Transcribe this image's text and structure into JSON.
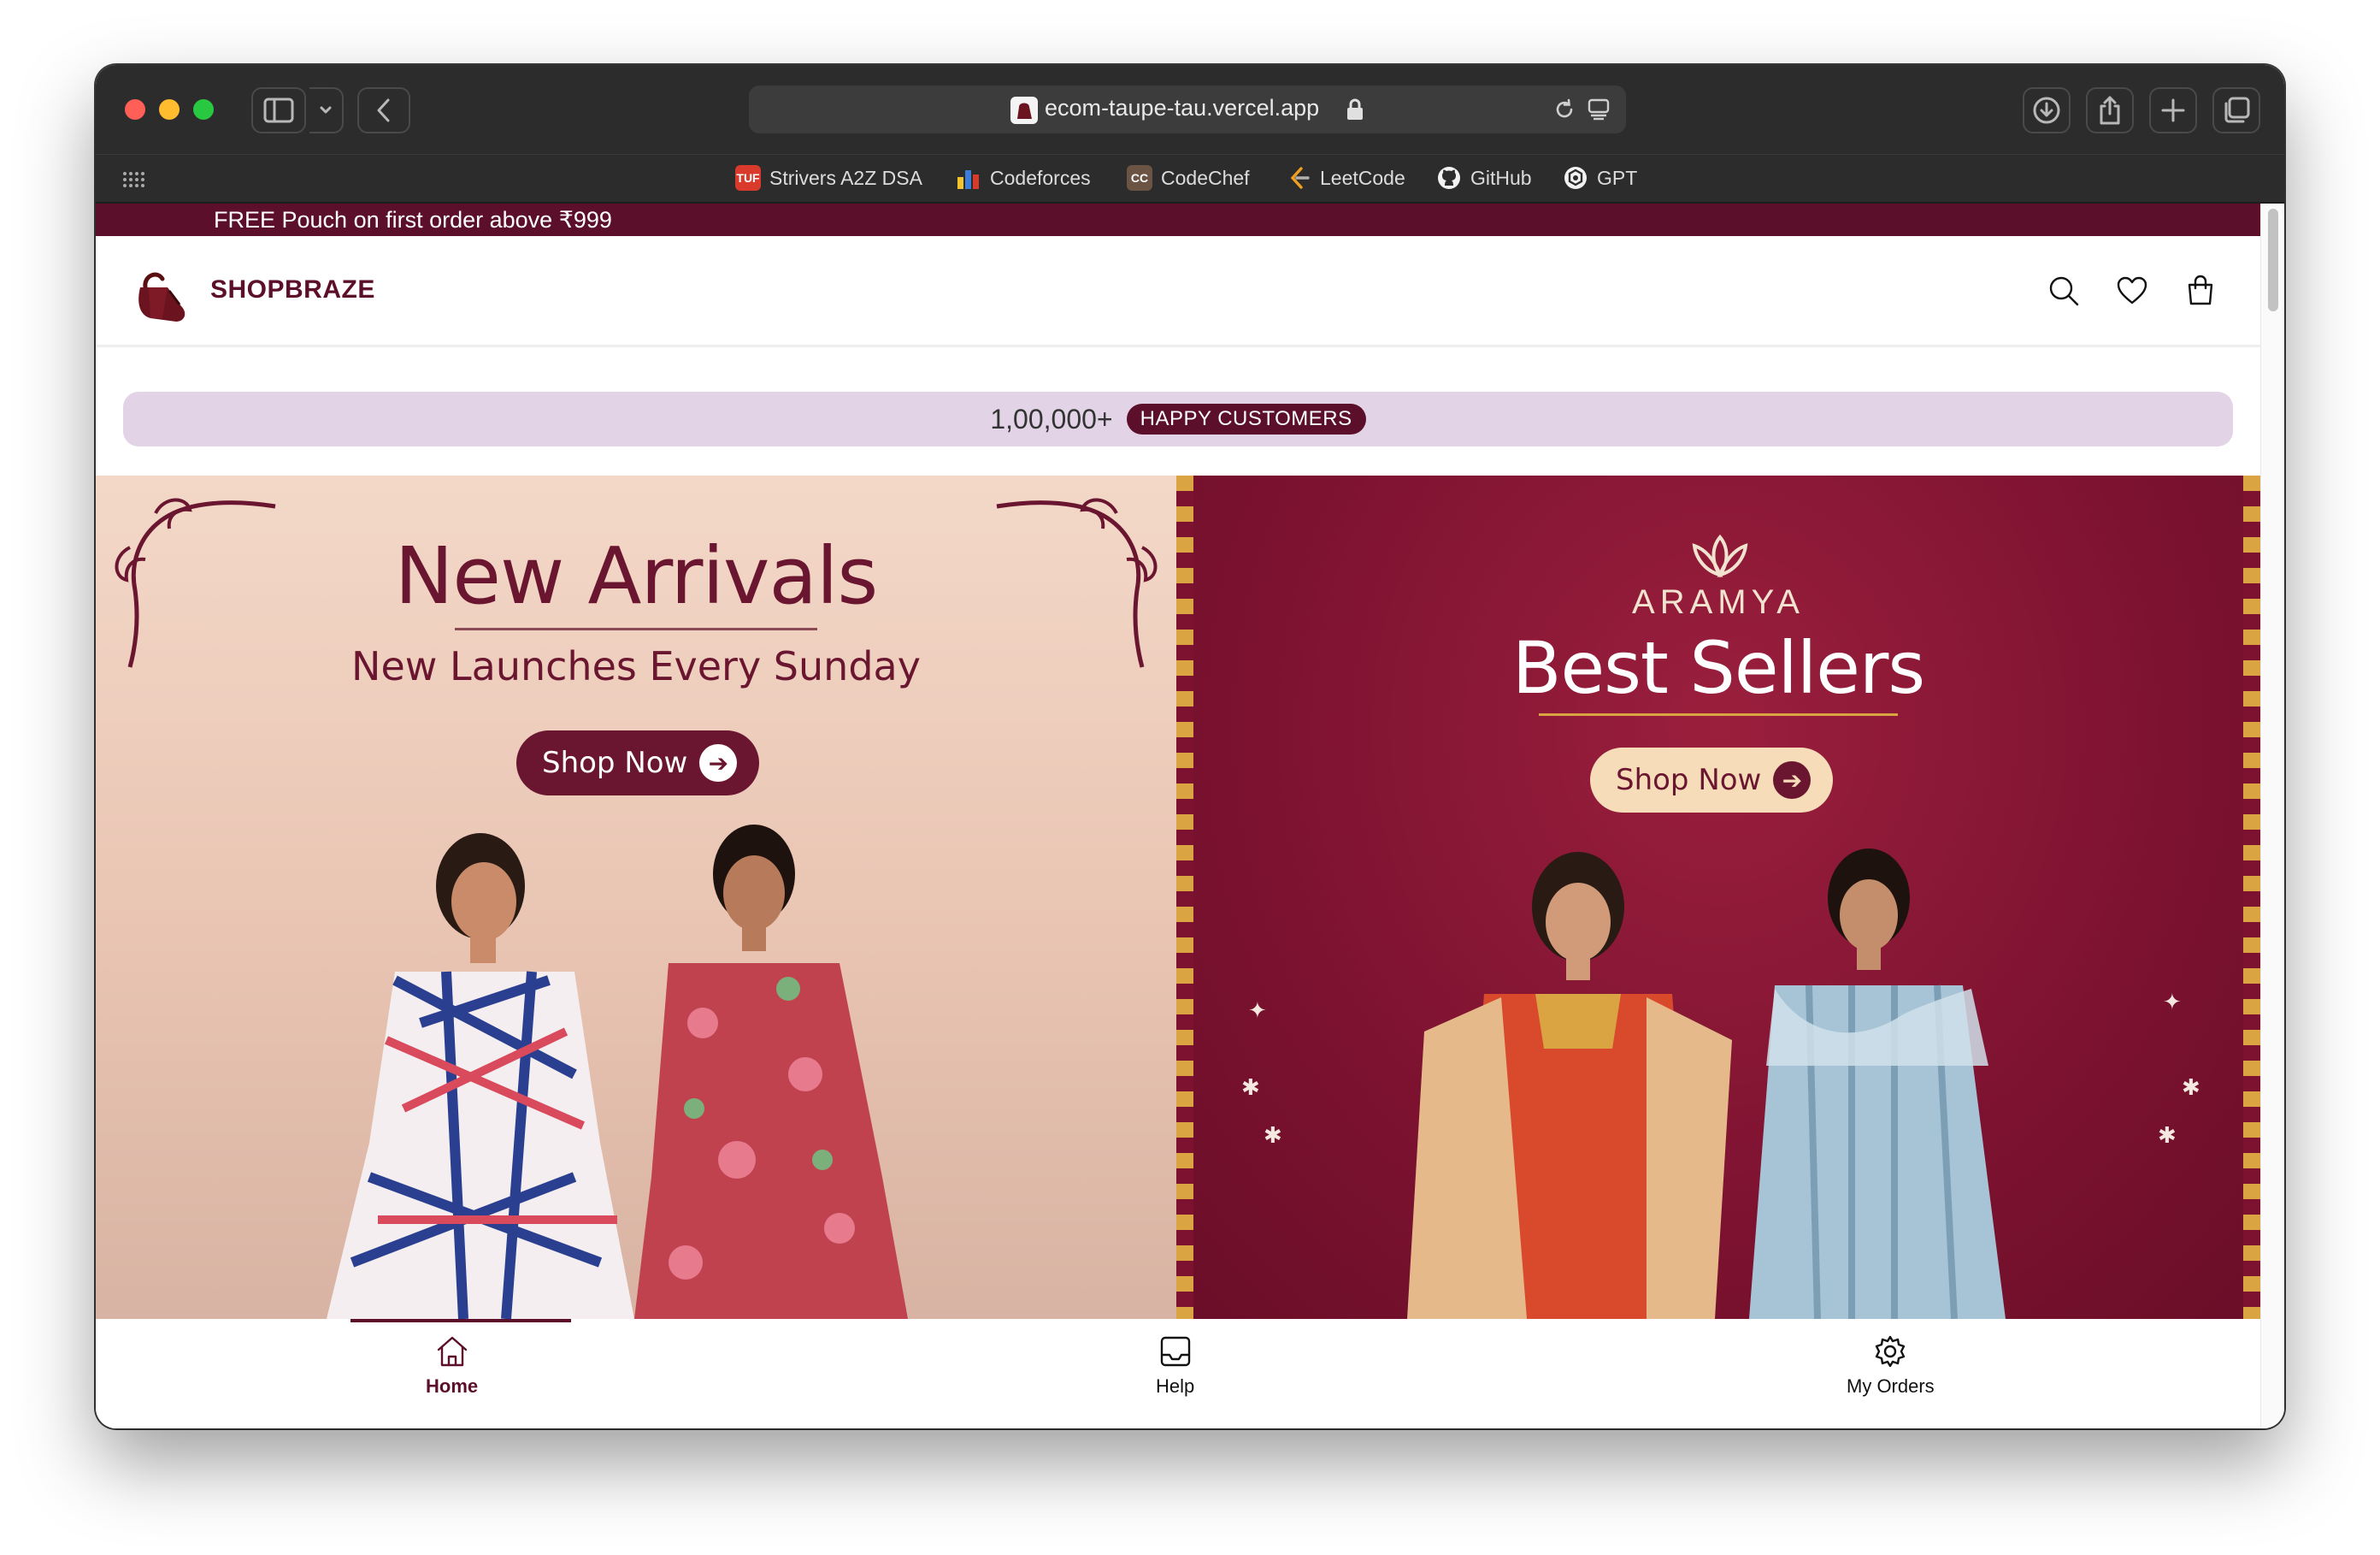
{
  "browser": {
    "url": "ecom-taupe-tau.vercel.app",
    "favorites": [
      {
        "label": "Strivers A2Z DSA",
        "icon": "tuf-icon",
        "color": "#d93a2b"
      },
      {
        "label": "Codeforces",
        "icon": "codeforces-icon",
        "color": "#3b7dd8"
      },
      {
        "label": "CodeChef",
        "icon": "codechef-icon",
        "color": "#6b5444"
      },
      {
        "label": "LeetCode",
        "icon": "leetcode-icon",
        "color": "#f0a020"
      },
      {
        "label": "GitHub",
        "icon": "github-icon",
        "color": "#ffffff"
      },
      {
        "label": "GPT",
        "icon": "openai-icon",
        "color": "#ffffff"
      }
    ]
  },
  "promo": {
    "text": "FREE Pouch on first order above ₹999"
  },
  "header": {
    "brand": "SHOPBRAZE"
  },
  "stats": {
    "count": "1,00,000+",
    "badge": "HAPPY CUSTOMERS"
  },
  "banners": {
    "left": {
      "title": "New Arrivals",
      "subtitle": "New Launches Every Sunday",
      "button": "Shop Now"
    },
    "right": {
      "brand": "ARAMYA",
      "title": "Best Sellers",
      "button": "Shop Now"
    }
  },
  "bottom_nav": {
    "items": [
      {
        "label": "Home",
        "icon": "home-icon",
        "active": true
      },
      {
        "label": "Help",
        "icon": "inbox-icon",
        "active": false
      },
      {
        "label": "My Orders",
        "icon": "gear-icon",
        "active": false
      }
    ]
  },
  "colors": {
    "brand": "#5c0f2a",
    "counter_bg": "#e2d4e6",
    "banner_right_bg": "#7c1230",
    "banner_left_bg": "#efd2c2"
  }
}
